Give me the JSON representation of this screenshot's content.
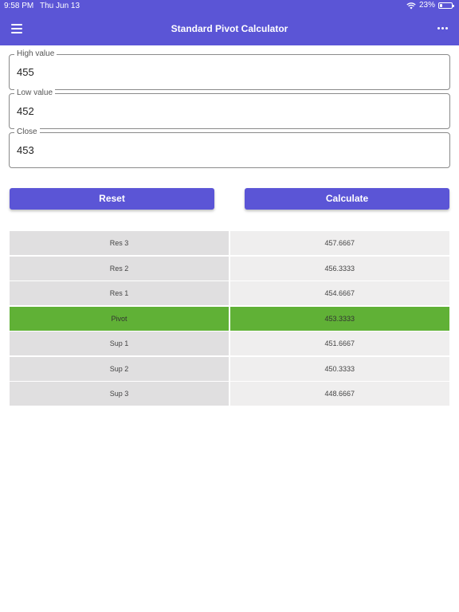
{
  "status_bar": {
    "time": "9:58 PM",
    "date": "Thu Jun 13",
    "battery": "23%",
    "battery_level": 0.23
  },
  "app_bar": {
    "title": "Standard Pivot Calculator",
    "menu_icon": "hamburger-menu-icon",
    "more_icon": "more-horizontal-icon"
  },
  "form": {
    "high": {
      "label": "High value",
      "value": "455"
    },
    "low": {
      "label": "Low value",
      "value": "452"
    },
    "close": {
      "label": "Close",
      "value": "453"
    }
  },
  "buttons": {
    "reset": "Reset",
    "calculate": "Calculate"
  },
  "colors": {
    "primary": "#5b55d6",
    "pivot_highlight": "#60b136"
  },
  "results": [
    {
      "label": "Res 3",
      "value": "457.6667"
    },
    {
      "label": "Res 2",
      "value": "456.3333"
    },
    {
      "label": "Res 1",
      "value": "454.6667"
    },
    {
      "label": "Pivot",
      "value": "453.3333"
    },
    {
      "label": "Sup 1",
      "value": "451.6667"
    },
    {
      "label": "Sup 2",
      "value": "450.3333"
    },
    {
      "label": "Sup 3",
      "value": "448.6667"
    }
  ]
}
